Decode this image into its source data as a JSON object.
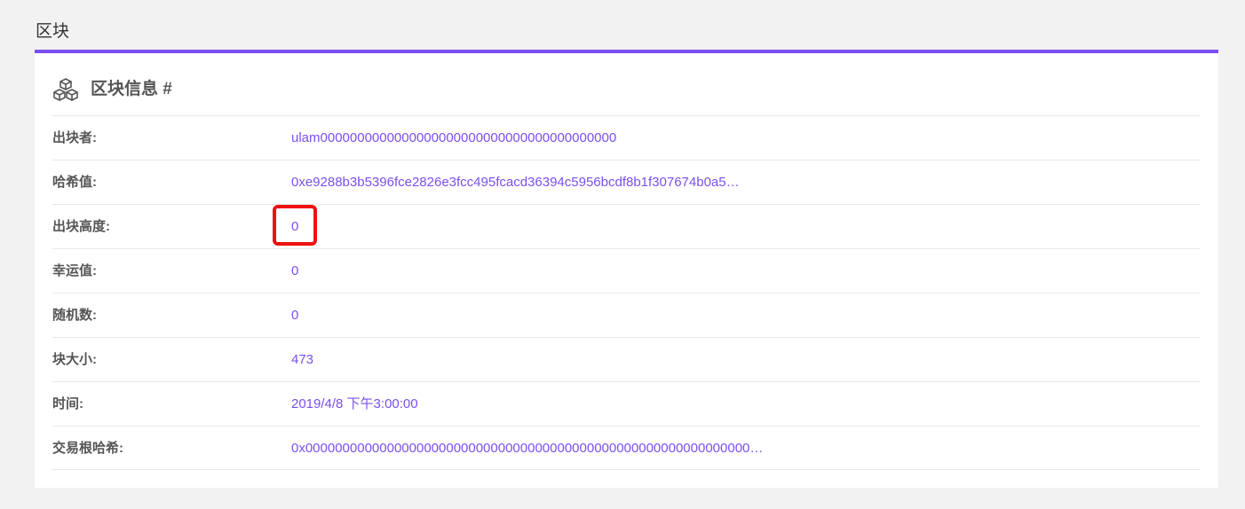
{
  "page": {
    "heading": "区块"
  },
  "panel": {
    "title": "区块信息 #",
    "icon": "cubes-icon"
  },
  "block_info": [
    {
      "label": "出块者:",
      "value": "ulam0000000000000000000000000000000000000000"
    },
    {
      "label": "哈希值:",
      "value": "0xe9288b3b5396fce2826e3fcc495fcacd36394c5956bcdf8b1f307674b0a5…"
    },
    {
      "label": "出块高度:",
      "value": "0"
    },
    {
      "label": "幸运值:",
      "value": "0"
    },
    {
      "label": "随机数:",
      "value": "0"
    },
    {
      "label": "块大小:",
      "value": "473"
    },
    {
      "label": "时间:",
      "value": "2019/4/8 下午3:00:00"
    },
    {
      "label": "交易根哈希:",
      "value": "0x000000000000000000000000000000000000000000000000000000000000…"
    }
  ],
  "colors": {
    "accent": "#7b4ff0",
    "highlight": "#ee1111",
    "background": "#f2f2f2"
  }
}
